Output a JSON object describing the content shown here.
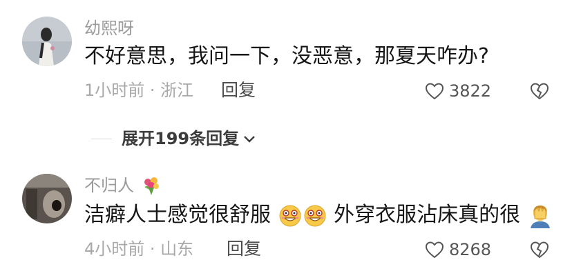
{
  "comments": [
    {
      "username": "幼熙呀",
      "text": "不好意思，我问一下，没恶意，那夏天咋办?",
      "time_location": "1小时前 · 浙江",
      "reply_label": "回复",
      "likes": "3822"
    },
    {
      "username": "不归人",
      "text_part1": "洁癖人士感觉很舒服",
      "text_part2": "外穿衣服沾床真的很",
      "time_location": "4小时前 · 山东",
      "reply_label": "回复",
      "likes": "8268"
    }
  ],
  "expand_replies_label": "展开199条回复",
  "icons": {
    "like": "heart-outline-icon",
    "dislike": "broken-heart-icon",
    "expand": "chevron-down-icon",
    "emoji_grin": "grinning-face-emoji",
    "emoji_facepalm": "facepalm-emoji",
    "username_badge": "bouquet-emoji"
  }
}
